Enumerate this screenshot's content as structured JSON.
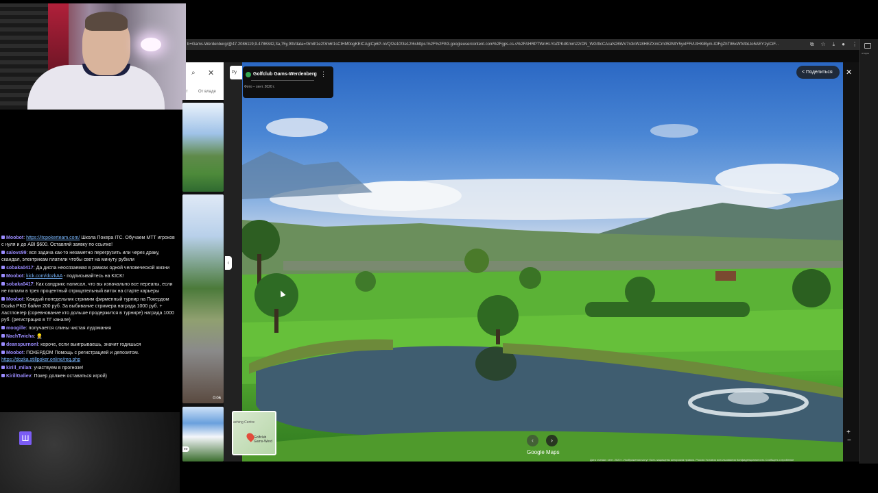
{
  "browser": {
    "url": "b+Gams-Werdenberg/@47.2086119,9.4786342,3a,75y,90t/data=!3m8!1e2!3m6!1sCIHM0ogKEICAgICp6P-nVQ!2e10!3e12!6shttps:%2F%2Flh3.googleusercontent.com%2Fgps-cs-s%2FAHRPTWnHl-YoZPKdKmm22rDN_WGt9cCAcaN26WV7n3nWz8HEZXmCm052MtY5yxIFFi/UtHKiBym-lOFgZhT86xWtVtbLto5AEY1yiCiF..."
  },
  "maps": {
    "filter_label": "т",
    "filter_owner": "От владе",
    "lang": "Ру",
    "place_title": "Golfclub Gams-Werdenberg",
    "photo_date": "Фото – сент. 2020 г.",
    "share": "Поделиться",
    "video_duration": "0:06",
    "thumb_label": "ео",
    "minimap_name": "Golfclub Gams-Werd",
    "minimap_area": "aching Centre",
    "brand": "Google Maps",
    "footer": "Дата съемки: сент. 2020 г.   Изображения могут быть защищены авторским правом.   Россия   Условия использования   Конфиденциальность   Сообщить о проблеме"
  },
  "chat": [
    {
      "user": "Moobot",
      "text": "Школа Покера ITC. Обучаем МТТ игроков с нуля и до ABI $600. Оставляй заявку по ссылке!",
      "link": "https://itcpokerteam.com/",
      "color": "#9b8cff"
    },
    {
      "user": "salovs99",
      "text": "вся задача как-то незаметно перегрузить или через драку, скандал, электрикам платили чтобы свет на минуту рубили",
      "link": "",
      "color": "#9b8cff"
    },
    {
      "user": "sobaka0417",
      "text": "Да диспа неосязаемая в рамках одной человеческой жизни",
      "link": "",
      "color": "#9b8cff"
    },
    {
      "user": "Moobot",
      "text": "- подписывайтесь на KICK!",
      "link": "kick.com/dozkAA",
      "color": "#9b8cff"
    },
    {
      "user": "sobaka0417",
      "text": "Как сандрикс написал, что вы изначально все переапы, если не попали в трех процентный отрицательный виток на старте карьеры",
      "link": "",
      "color": "#9b8cff"
    },
    {
      "user": "Moobot",
      "text": "Каждый понедельник стримим фирменный турнир на Покердом Dozka PKO байин 200 руб. За выбивание стримера награда 1000 руб. + ластлонгер (соревнование кто дольше продержится в турнире) награда 1000 руб. (регистрация в ТГ канале)",
      "link": "",
      "color": "#9b8cff"
    },
    {
      "user": "moogille",
      "text": "получается слины чистая лудомания",
      "link": "",
      "color": "#9b8cff"
    },
    {
      "user": "NachTwicha",
      "text": "👷",
      "link": "",
      "color": "#9b8cff"
    },
    {
      "user": "deanspurnonl",
      "text": "короче, если выигрываешь, значит годишься",
      "link": "",
      "color": "#9b8cff"
    },
    {
      "user": "Moobot",
      "text": "ПОКЕРДОМ Помощь с регистрацией и депозитом.",
      "link": "https://dozka.stillpoker.online/reg.php",
      "color": "#9b8cff"
    },
    {
      "user": "kirill_milan",
      "text": "участвуем в прогнозе!",
      "link": "",
      "color": "#9b8cff"
    },
    {
      "user": "KirillGaliev",
      "text": "Покер должен оставаться игрой)",
      "link": "",
      "color": "#9b8cff"
    }
  ],
  "right_sidebar_label": "оторы"
}
